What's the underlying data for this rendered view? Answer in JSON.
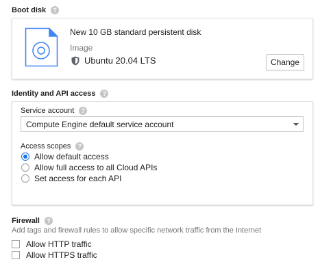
{
  "boot_disk": {
    "title": "Boot disk",
    "help": "?",
    "disk_name": "New 10 GB standard persistent disk",
    "disk_type": "Image",
    "os_name": "Ubuntu 20.04 LTS",
    "change_label": "Change"
  },
  "identity": {
    "title": "Identity and API access",
    "help": "?",
    "service_account_label": "Service account",
    "service_account_value": "Compute Engine default service account",
    "access_scopes_label": "Access scopes",
    "scopes": [
      {
        "label": "Allow default access",
        "checked": true
      },
      {
        "label": "Allow full access to all Cloud APIs",
        "checked": false
      },
      {
        "label": "Set access for each API",
        "checked": false
      }
    ]
  },
  "firewall": {
    "title": "Firewall",
    "help": "?",
    "description": "Add tags and firewall rules to allow specific network traffic from the Internet",
    "options": [
      {
        "label": "Allow HTTP traffic",
        "checked": false
      },
      {
        "label": "Allow HTTPS traffic",
        "checked": false
      }
    ]
  },
  "colors": {
    "accent": "#1a73e8",
    "icon_blue": "#4285f4"
  }
}
